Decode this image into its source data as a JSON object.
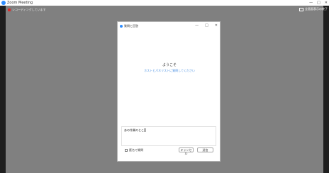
{
  "window": {
    "title": "Zoom Meeting",
    "controls": [
      "—",
      "□",
      "✕"
    ]
  },
  "recording": {
    "label": "レコーディングしています"
  },
  "view": {
    "label": "全画面表示の終了"
  },
  "dialog": {
    "title": "質問と回答",
    "controls": [
      "—",
      "□",
      "✕"
    ],
    "welcome_title": "ようこそ",
    "welcome_subtitle": "ホストとパネリストに質問してください",
    "input": {
      "value": "あの作業のとこ"
    },
    "anonymous_label": "匿名で質問",
    "cancel_label": "キャンセル",
    "submit_label": "送信"
  },
  "colors": {
    "accent": "#2d8cff",
    "record": "#e02828",
    "background": "#808080"
  }
}
